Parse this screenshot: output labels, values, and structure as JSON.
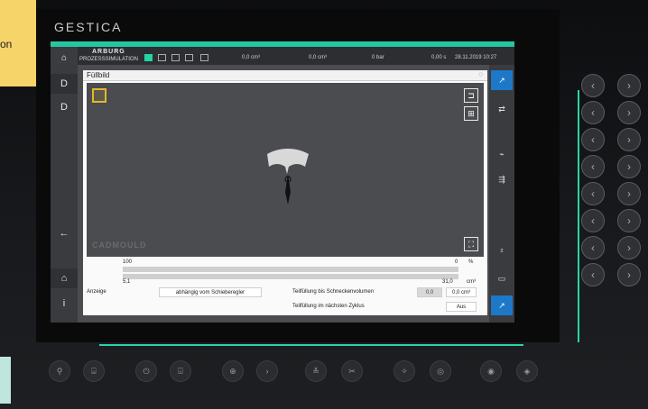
{
  "note": {
    "text": "on"
  },
  "brand": "GESTICA",
  "topbar": {
    "logo": "ARBURG",
    "mode": "PROZESSSIMULATION",
    "readouts": [
      "0,0 cm³",
      "0,0 cm³",
      "0 bar",
      "0,00 s"
    ],
    "datetime": "28.11.2019 10:27"
  },
  "select": {
    "value": "Füllbild"
  },
  "viewport": {
    "watermark": "CADMOULD"
  },
  "progress": {
    "top_left": "100",
    "top_right": "0",
    "top_unit": "%",
    "bottom_left": "5,1",
    "bottom_right": "31,0",
    "bottom_unit": "cm³"
  },
  "form": {
    "row1": {
      "label": "Anzeige",
      "value": "abhängig vom Schieberegler",
      "label2": "Teilfüllung bis Schneckenvolumen",
      "value2a": "0,0",
      "value2b": "0,0 cm³"
    },
    "row2": {
      "label": "Teilfüllung im nächsten Zyklus",
      "value": "Aus"
    }
  },
  "leftnav": {
    "items": [
      "D",
      "D",
      "←",
      "⌂",
      "i"
    ]
  },
  "colors": {
    "accent": "#25c7a3",
    "blue": "#1d78c8",
    "gold": "#e5b62a"
  }
}
